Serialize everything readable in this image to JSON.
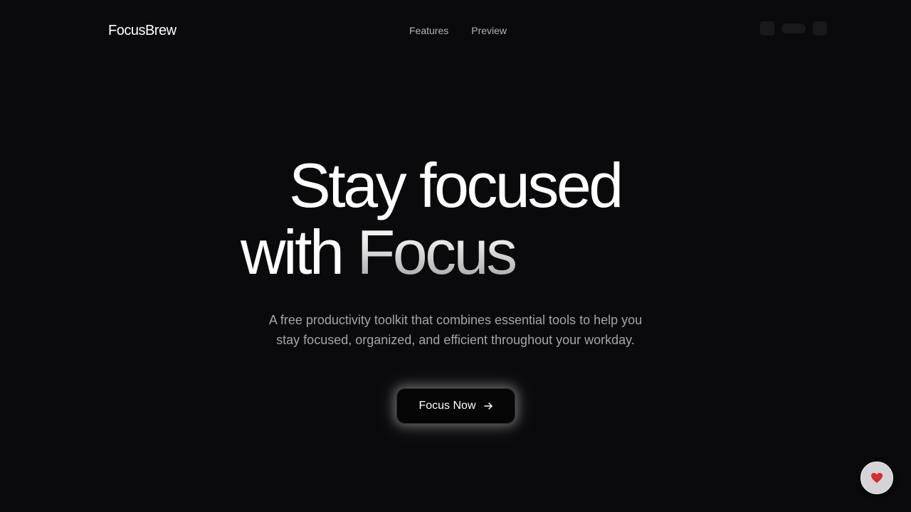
{
  "nav": {
    "brand": "FocusBrew",
    "links": [
      "Features",
      "Preview"
    ]
  },
  "hero": {
    "title_line_1": "Stay focused",
    "title_line_2_prefix": "with ",
    "title_line_2_accent": "Focus",
    "subtitle_line_1": "A free productivity toolkit that combines essential tools to help you",
    "subtitle_line_2": "stay focused, organized, and efficient throughout your workday.",
    "cta_label": "Focus Now",
    "cta_icon": "arrow-right-icon"
  },
  "floating": {
    "icon": "heart-icon",
    "icon_color": "#d92b2b"
  },
  "colors": {
    "background": "#0a0a0c",
    "text_primary": "#ffffff",
    "text_muted": "#a4a4aa",
    "button_bg": "#050505"
  }
}
